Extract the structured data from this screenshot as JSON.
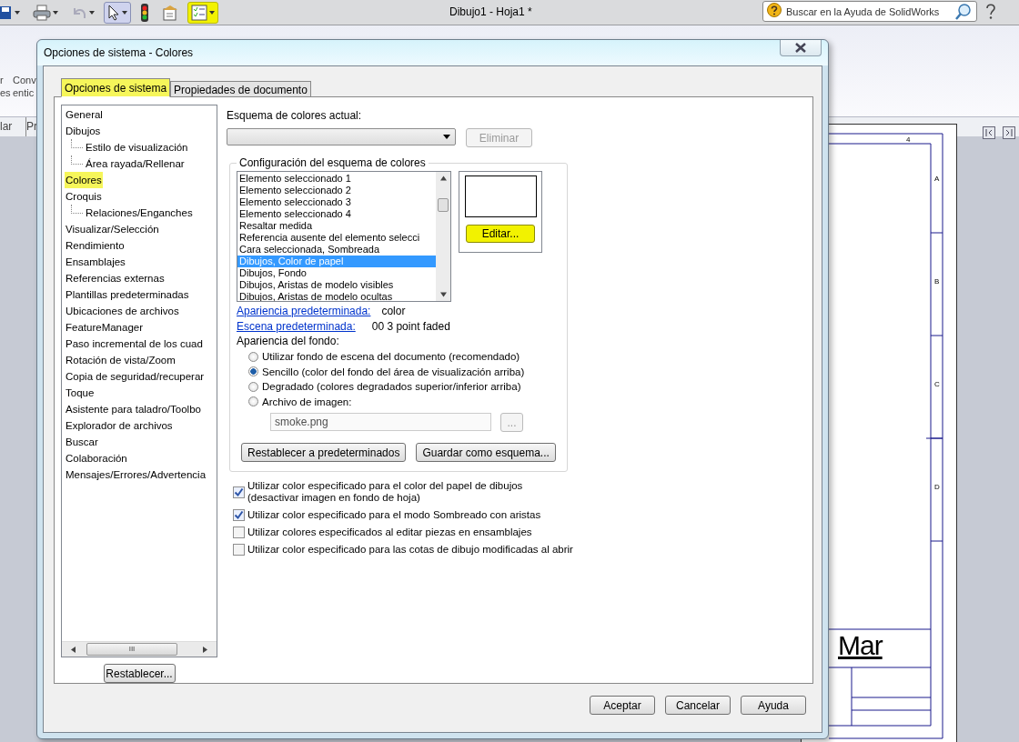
{
  "app": {
    "title": "Dibujo1 - Hoja1 *",
    "toolbar": [
      {
        "kind": "save",
        "highlighted": false,
        "pressed": false
      },
      {
        "kind": "print",
        "highlighted": false,
        "pressed": false
      },
      {
        "kind": "undo",
        "highlighted": false,
        "pressed": false
      },
      {
        "kind": "select",
        "highlighted": false,
        "pressed": true
      },
      {
        "kind": "traffic",
        "highlighted": false,
        "pressed": false
      },
      {
        "kind": "properties",
        "highlighted": false,
        "pressed": false
      },
      {
        "kind": "options",
        "highlighted": true,
        "pressed": false
      }
    ],
    "search": {
      "placeholder": "Buscar en la Ayuda de SolidWorks"
    },
    "ribbon_fragments": [
      "r",
      "es",
      "Conv",
      "entic"
    ],
    "tab_fragments": [
      "lar",
      "Pr"
    ],
    "sheet": {
      "top_zone": "4",
      "side_zones": [
        "A",
        "B",
        "C",
        "D"
      ],
      "logo": "Mar"
    }
  },
  "dialog": {
    "title": "Opciones de sistema - Colores",
    "tabs": [
      {
        "label": "Opciones de sistema",
        "selected": true,
        "highlighted": true
      },
      {
        "label": "Propiedades de documento",
        "selected": false,
        "highlighted": false
      }
    ],
    "tree": [
      {
        "label": "General",
        "highlighted": false
      },
      {
        "label": "Dibujos",
        "highlighted": false,
        "children": [
          {
            "label": "Estilo de visualización",
            "highlighted": false
          },
          {
            "label": "Área rayada/Rellenar",
            "highlighted": false
          }
        ]
      },
      {
        "label": "Colores",
        "highlighted": true
      },
      {
        "label": "Croquis",
        "highlighted": false,
        "children": [
          {
            "label": "Relaciones/Enganches",
            "highlighted": false
          }
        ]
      },
      {
        "label": "Visualizar/Selección",
        "highlighted": false
      },
      {
        "label": "Rendimiento",
        "highlighted": false
      },
      {
        "label": "Ensamblajes",
        "highlighted": false
      },
      {
        "label": "Referencias externas",
        "highlighted": false
      },
      {
        "label": "Plantillas predeterminadas",
        "highlighted": false
      },
      {
        "label": "Ubicaciones de archivos",
        "highlighted": false
      },
      {
        "label": "FeatureManager",
        "highlighted": false
      },
      {
        "label": "Paso incremental de los cuad",
        "highlighted": false
      },
      {
        "label": "Rotación de vista/Zoom",
        "highlighted": false
      },
      {
        "label": "Copia de seguridad/recuperar",
        "highlighted": false
      },
      {
        "label": "Toque",
        "highlighted": false
      },
      {
        "label": "Asistente para taladro/Toolbo",
        "highlighted": false
      },
      {
        "label": "Explorador de archivos",
        "highlighted": false
      },
      {
        "label": "Buscar",
        "highlighted": false
      },
      {
        "label": "Colaboración",
        "highlighted": false
      },
      {
        "label": "Mensajes/Errores/Advertencia",
        "highlighted": false
      }
    ],
    "tree_scrollbar": "III",
    "reset_button": "Restablecer...",
    "scheme_label": "Esquema de colores actual:",
    "delete_button": {
      "label": "Eliminar",
      "disabled": true
    },
    "group_title": "Configuración del esquema de colores",
    "color_items": [
      {
        "label": "Elemento seleccionado 1",
        "selected": false
      },
      {
        "label": "Elemento seleccionado 2",
        "selected": false
      },
      {
        "label": "Elemento seleccionado 3",
        "selected": false
      },
      {
        "label": "Elemento seleccionado 4",
        "selected": false
      },
      {
        "label": "Resaltar medida",
        "selected": false
      },
      {
        "label": "Referencia ausente del elemento selecci",
        "selected": false
      },
      {
        "label": "Cara seleccionada, Sombreada",
        "selected": false
      },
      {
        "label": "Dibujos, Color de papel",
        "selected": true
      },
      {
        "label": "Dibujos, Fondo",
        "selected": false
      },
      {
        "label": "Dibujos, Aristas de modelo visibles",
        "selected": false
      },
      {
        "label": "Dibujos, Aristas de modelo ocultas",
        "selected": false
      }
    ],
    "swatch": {
      "color": "#ffffff"
    },
    "edit_button": {
      "label": "Editar...",
      "highlighted": true
    },
    "links": [
      {
        "label": "Apariencia predeterminada:",
        "value": "color"
      },
      {
        "label": "Escena predeterminada:",
        "value": "00 3 point faded"
      }
    ],
    "background_label": "Apariencia del fondo:",
    "radios": [
      {
        "label": "Utilizar fondo de escena del documento (recomendado)",
        "selected": false
      },
      {
        "label": "Sencillo (color del fondo del área de visualización arriba)",
        "selected": true
      },
      {
        "label": "Degradado (colores degradados superior/inferior arriba)",
        "selected": false
      },
      {
        "label": "Archivo de imagen:",
        "selected": false
      }
    ],
    "image_file": {
      "value": "smoke.png",
      "disabled": true
    },
    "browse_button": "...",
    "group_buttons": [
      "Restablecer a predeterminados",
      "Guardar como esquema..."
    ],
    "checkboxes": [
      {
        "label": "Utilizar color especificado para el color del papel de dibujos\n(desactivar imagen en fondo de hoja)",
        "checked": true
      },
      {
        "label": "Utilizar color especificado para el modo Sombreado con aristas",
        "checked": true
      },
      {
        "label": "Utilizar colores especificados al editar piezas en ensamblajes",
        "checked": false
      },
      {
        "label": "Utilizar color especificado para las cotas de dibujo modificadas al abrir",
        "checked": false
      }
    ],
    "buttons": [
      "Aceptar",
      "Cancelar",
      "Ayuda"
    ]
  }
}
